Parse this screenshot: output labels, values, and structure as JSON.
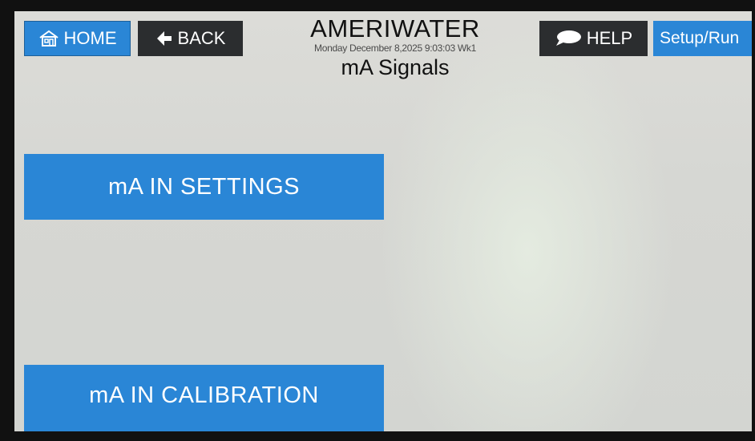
{
  "header": {
    "brand": "AMERIWATER",
    "datetime": "Monday December 8,2025 9:03:03 Wk1",
    "page_title": "mA Signals"
  },
  "nav": {
    "home_label": "HOME",
    "back_label": "BACK",
    "help_label": "HELP",
    "setup_label": "Setup/Run"
  },
  "main": {
    "settings_label": "mA IN SETTINGS",
    "calibration_label": "mA IN CALIBRATION"
  },
  "colors": {
    "accent_blue": "#2a86d6",
    "dark_button": "#2b2d2f",
    "screen_bg": "#d6d7d3"
  },
  "icons": {
    "home": "home-icon",
    "back": "back-arrow-icon",
    "help": "speech-bubble-icon"
  }
}
